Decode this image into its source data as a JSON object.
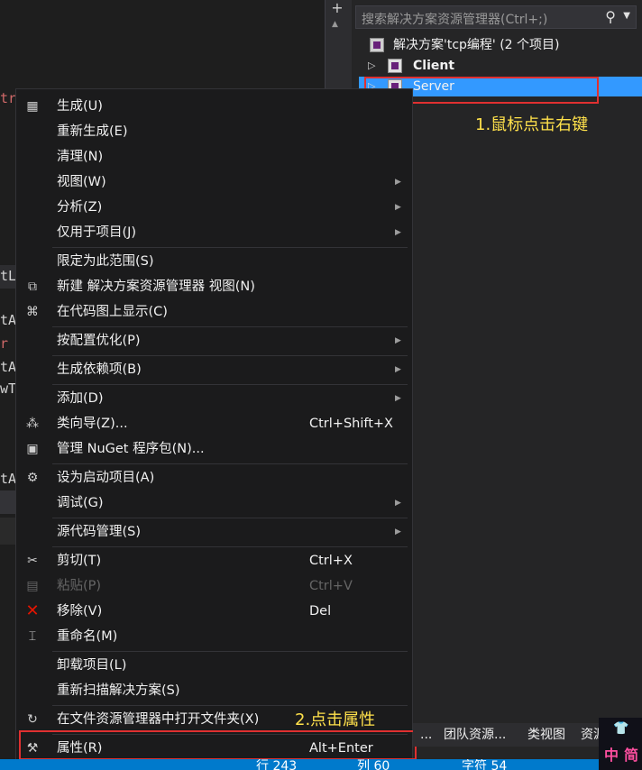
{
  "editor": {
    "fragments": [
      {
        "text": "tr",
        "color": "#d16969"
      },
      {
        "text": "tL",
        "color": "#d4d4d4"
      },
      {
        "text": "tA",
        "color": "#d4d4d4"
      },
      {
        "text": "r",
        "color": "#d16969"
      },
      {
        "text": "tA",
        "color": "#d4d4d4"
      },
      {
        "text": "wT",
        "color": "#d4d4d4"
      },
      {
        "text": "tA",
        "color": "#d4d4d4"
      }
    ],
    "split_button": "+"
  },
  "solution_explorer": {
    "search_placeholder": "搜索解决方案资源管理器(Ctrl+;)",
    "solution_label": "解决方案'tcp编程' (2 个项目)",
    "projects": [
      {
        "label": "Client",
        "bold": true
      },
      {
        "label": "Server",
        "selected": true
      }
    ]
  },
  "annotations": {
    "step1": "1.鼠标点击右键",
    "step2": "2.点击属性"
  },
  "context_menu": {
    "items": [
      {
        "icon": "build-icon",
        "glyph": "▦",
        "label": "生成(U)"
      },
      {
        "label": "重新生成(E)"
      },
      {
        "label": "清理(N)"
      },
      {
        "label": "视图(W)",
        "submenu": true
      },
      {
        "label": "分析(Z)",
        "submenu": true
      },
      {
        "label": "仅用于项目(J)",
        "submenu": true
      },
      {
        "label": "限定为此范围(S)"
      },
      {
        "icon": "new-view-icon",
        "glyph": "⧉",
        "label": "新建 解决方案资源管理器 视图(N)"
      },
      {
        "icon": "code-map-icon",
        "glyph": "⌘",
        "label": "在代码图上显示(C)"
      },
      {
        "label": "按配置优化(P)",
        "submenu": true
      },
      {
        "label": "生成依赖项(B)",
        "submenu": true
      },
      {
        "label": "添加(D)",
        "submenu": true
      },
      {
        "icon": "class-wizard-icon",
        "glyph": "⁂",
        "label": "类向导(Z)...",
        "shortcut": "Ctrl+Shift+X"
      },
      {
        "icon": "nuget-icon",
        "glyph": "▣",
        "label": "管理 NuGet 程序包(N)..."
      },
      {
        "icon": "gear-icon",
        "glyph": "⚙",
        "label": "设为启动项目(A)"
      },
      {
        "label": "调试(G)",
        "submenu": true
      },
      {
        "label": "源代码管理(S)",
        "submenu": true
      },
      {
        "icon": "scissors-icon",
        "glyph": "✂",
        "label": "剪切(T)",
        "shortcut": "Ctrl+X"
      },
      {
        "icon": "paste-icon",
        "glyph": "📋",
        "label": "粘贴(P)",
        "shortcut": "Ctrl+V",
        "disabled": true
      },
      {
        "icon": "remove-icon",
        "glyph": "✕",
        "label": "移除(V)",
        "shortcut": "Del",
        "icon_color": "#e51400"
      },
      {
        "icon": "rename-icon",
        "glyph": "⌶",
        "label": "重命名(M)"
      },
      {
        "label": "卸载项目(L)"
      },
      {
        "label": "重新扫描解决方案(S)"
      },
      {
        "icon": "open-folder-icon",
        "glyph": "↻",
        "label": "在文件资源管理器中打开文件夹(X)"
      },
      {
        "icon": "wrench-icon",
        "glyph": "🔧",
        "label": "属性(R)",
        "shortcut": "Alt+Enter"
      }
    ]
  },
  "bottom_tabs": [
    "...",
    "团队资源...",
    "类视图",
    "资源"
  ],
  "status_bar": {
    "line": "行 243",
    "col": "列 60",
    "char": "字符 54"
  },
  "ime": {
    "top": "👕",
    "left": "中",
    "right": "简"
  }
}
